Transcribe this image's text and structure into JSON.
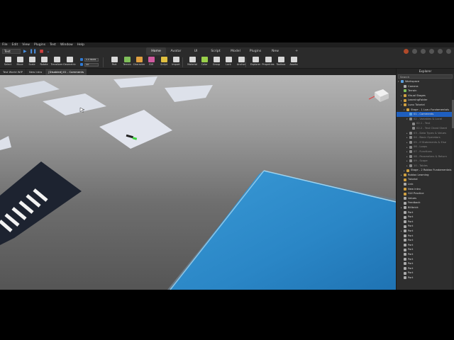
{
  "menubar": {
    "items": [
      "File",
      "Edit",
      "View",
      "Plugins",
      "Test",
      "Window",
      "Help"
    ]
  },
  "place_select": "Test",
  "ribbon_tabs": [
    "Home",
    "Avatar",
    "UI",
    "Script",
    "Model",
    "Plugins",
    "New"
  ],
  "active_ribbon_tab": "Home",
  "toolbar": {
    "tools": [
      {
        "label": "Select",
        "color": "#d8d8d8"
      },
      {
        "label": "Move",
        "color": "#d8d8d8"
      },
      {
        "label": "Scale",
        "color": "#d8d8d8"
      },
      {
        "label": "Rotate",
        "color": "#d8d8d8"
      },
      {
        "label": "Transform",
        "color": "#d8d8d8"
      },
      {
        "label": "Geometric",
        "color": "#d8d8d8"
      },
      {
        "label": "Part",
        "color": "#d8d8d8"
      },
      {
        "label": "Terrain",
        "color": "#7fbf5a"
      },
      {
        "label": "Character",
        "color": "#e0a040"
      },
      {
        "label": "GUI",
        "color": "#d05aa0"
      },
      {
        "label": "Script",
        "color": "#e0c040"
      },
      {
        "label": "Import",
        "color": "#d8d8d8"
      },
      {
        "label": "Material",
        "color": "#d8d8d8"
      },
      {
        "label": "Color",
        "color": "#9ad04a"
      },
      {
        "label": "Group",
        "color": "#d8d8d8"
      },
      {
        "label": "Lock",
        "color": "#d8d8d8"
      },
      {
        "label": "Anchor",
        "color": "#d8d8d8"
      },
      {
        "label": "Explorer",
        "color": "#d8d8d8"
      },
      {
        "label": "Properties",
        "color": "#d8d8d8"
      },
      {
        "label": "Toolbox",
        "color": "#d8d8d8"
      },
      {
        "label": "Assets",
        "color": "#d8d8d8"
      }
    ],
    "snap_move": "0.5 studs",
    "snap_rotate": "45°"
  },
  "doc_tabs": [
    {
      "label": "Test World WIP",
      "active": false
    },
    {
      "label": "New intro",
      "active": false
    },
    {
      "label": "[Disabled] 01 - Comments",
      "active": true
    }
  ],
  "explorer": {
    "title": "Explorer",
    "search_placeholder": "Search",
    "items": [
      {
        "label": "Workspace",
        "depth": 0,
        "color": "#5aa0e0",
        "arrow": "▾"
      },
      {
        "label": "Camera",
        "depth": 1,
        "color": "#aaaaaa",
        "arrow": ""
      },
      {
        "label": "Terrain",
        "depth": 1,
        "color": "#7fbf5a",
        "arrow": ""
      },
      {
        "label": "Visual Stages",
        "depth": 1,
        "color": "#d0a040",
        "arrow": "▸"
      },
      {
        "label": "LearningFolder",
        "depth": 1,
        "color": "#d0a040",
        "arrow": "▸"
      },
      {
        "label": "Luau Tutorial",
        "depth": 1,
        "color": "#d0a040",
        "arrow": "▾"
      },
      {
        "label": "Stage - 1 Luau Fundamentals",
        "depth": 2,
        "color": "#d0a040",
        "arrow": "▾"
      },
      {
        "label": "01 - Comments",
        "depth": 3,
        "color": "#5aa0e0",
        "arrow": "",
        "selected": true
      },
      {
        "label": "02 - Variables & Local",
        "depth": 3,
        "color": "#888888",
        "arrow": "▾",
        "dim": true
      },
      {
        "label": "02.1 - Test",
        "depth": 4,
        "color": "#888888",
        "arrow": "",
        "dim": true
      },
      {
        "label": "02.2 - Test Cheat Sheet",
        "depth": 4,
        "color": "#888888",
        "arrow": "",
        "dim": true
      },
      {
        "label": "03 - Data Types & Values",
        "depth": 3,
        "color": "#888888",
        "arrow": "▸",
        "dim": true
      },
      {
        "label": "04 - Basic Operators",
        "depth": 3,
        "color": "#888888",
        "arrow": "▸",
        "dim": true
      },
      {
        "label": "05 - If Statements & Else",
        "depth": 3,
        "color": "#888888",
        "arrow": "▸",
        "dim": true
      },
      {
        "label": "06 - Loops",
        "depth": 3,
        "color": "#888888",
        "arrow": "▸",
        "dim": true
      },
      {
        "label": "07 - Functions",
        "depth": 3,
        "color": "#888888",
        "arrow": "▸",
        "dim": true
      },
      {
        "label": "08 - Parameters & Return",
        "depth": 3,
        "color": "#888888",
        "arrow": "▸",
        "dim": true
      },
      {
        "label": "09 - Scope",
        "depth": 3,
        "color": "#888888",
        "arrow": "▸",
        "dim": true
      },
      {
        "label": "10 - Tables",
        "depth": 3,
        "color": "#888888",
        "arrow": "▸",
        "dim": true
      },
      {
        "label": "Stage - 2 Roblox Fundamentals",
        "depth": 2,
        "color": "#d0a040",
        "arrow": "▸"
      },
      {
        "label": "Roblox Learning",
        "depth": 1,
        "color": "#d0a040",
        "arrow": "▸"
      },
      {
        "label": "Tutorial",
        "depth": 1,
        "color": "#d0a040",
        "arrow": ""
      },
      {
        "label": "Link",
        "depth": 1,
        "color": "#aaaaaa",
        "arrow": ""
      },
      {
        "label": "New intro",
        "depth": 1,
        "color": "#d0a040",
        "arrow": ""
      },
      {
        "label": "GUI Practice",
        "depth": 1,
        "color": "#d0a040",
        "arrow": ""
      },
      {
        "label": "Values",
        "depth": 1,
        "color": "#aaaaaa",
        "arrow": ""
      },
      {
        "label": "Feedback",
        "depth": 1,
        "color": "#aaaaaa",
        "arrow": ""
      },
      {
        "label": "Billbrick",
        "depth": 1,
        "color": "#aaaaaa",
        "arrow": "▸"
      },
      {
        "label": "Part",
        "depth": 1,
        "color": "#aaaaaa",
        "arrow": ""
      },
      {
        "label": "Part",
        "depth": 1,
        "color": "#aaaaaa",
        "arrow": ""
      },
      {
        "label": "Part",
        "depth": 1,
        "color": "#aaaaaa",
        "arrow": ""
      },
      {
        "label": "Part",
        "depth": 1,
        "color": "#aaaaaa",
        "arrow": ""
      },
      {
        "label": "Part",
        "depth": 1,
        "color": "#aaaaaa",
        "arrow": "▸"
      },
      {
        "label": "Part",
        "depth": 1,
        "color": "#aaaaaa",
        "arrow": ""
      },
      {
        "label": "Part",
        "depth": 1,
        "color": "#aaaaaa",
        "arrow": ""
      },
      {
        "label": "Part",
        "depth": 1,
        "color": "#aaaaaa",
        "arrow": ""
      },
      {
        "label": "Part",
        "depth": 1,
        "color": "#aaaaaa",
        "arrow": ""
      },
      {
        "label": "Part",
        "depth": 1,
        "color": "#aaaaaa",
        "arrow": ""
      },
      {
        "label": "Part",
        "depth": 1,
        "color": "#aaaaaa",
        "arrow": ""
      },
      {
        "label": "Part",
        "depth": 1,
        "color": "#aaaaaa",
        "arrow": ""
      },
      {
        "label": "Part",
        "depth": 1,
        "color": "#aaaaaa",
        "arrow": ""
      },
      {
        "label": "Part",
        "depth": 1,
        "color": "#aaaaaa",
        "arrow": ""
      },
      {
        "label": "Part",
        "depth": 1,
        "color": "#aaaaaa",
        "arrow": ""
      }
    ]
  },
  "colors": {
    "selection": "#1f5fbf",
    "water": "#2f8fcf",
    "panel": "#2e2e2e"
  }
}
